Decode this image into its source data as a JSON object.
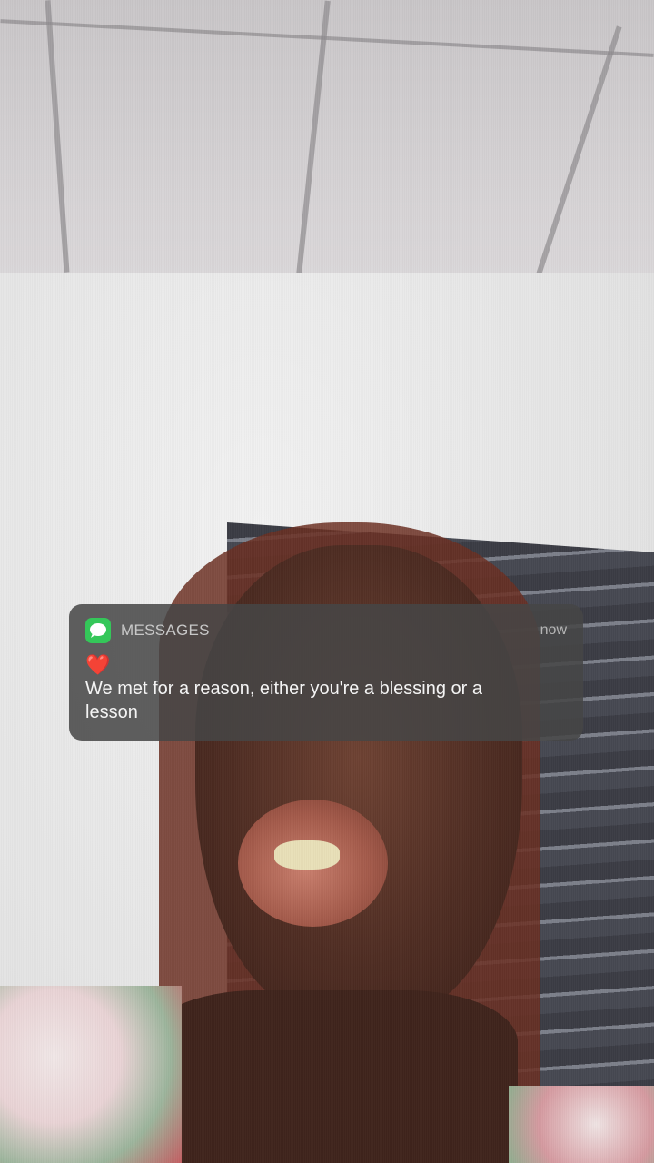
{
  "notification": {
    "app_name": "MESSAGES",
    "app_icon": "messages-bubble-icon",
    "app_icon_color": "#34c759",
    "time": "now",
    "emoji": "❤️",
    "message": "We met for a reason, either you're a blessing or a lesson"
  },
  "background": {
    "description_icon": "selfie-photo"
  }
}
